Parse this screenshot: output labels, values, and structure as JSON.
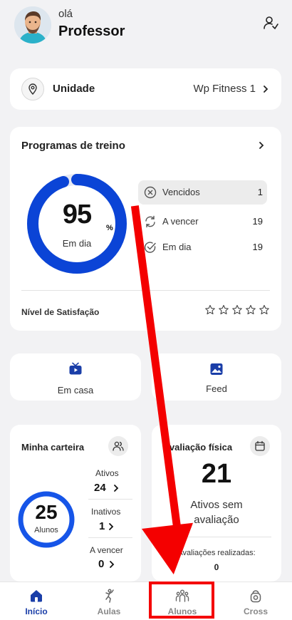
{
  "header": {
    "greeting": "olá",
    "user_name": "Professor"
  },
  "unit": {
    "label": "Unidade",
    "value": "Wp Fitness 1"
  },
  "programs": {
    "title": "Programas de treino",
    "percent": "95",
    "percent_sign": "%",
    "status": "Em dia",
    "progress_fraction": 0.95,
    "stats": [
      {
        "label": "Vencidos",
        "value": "1",
        "icon": "x-circle-icon"
      },
      {
        "label": "A vencer",
        "value": "19",
        "icon": "refresh-icon"
      },
      {
        "label": "Em dia",
        "value": "19",
        "icon": "check-circle-icon"
      }
    ],
    "satisfaction_label": "Nível de Satisfação",
    "stars": 0
  },
  "shortcuts": [
    {
      "label": "Em casa",
      "icon": "tv-icon"
    },
    {
      "label": "Feed",
      "icon": "image-icon"
    }
  ],
  "wallet": {
    "title": "Minha carteira",
    "total": "25",
    "total_label": "Alunos",
    "items": [
      {
        "label": "Ativos",
        "value": "24"
      },
      {
        "label": "Inativos",
        "value": "1"
      },
      {
        "label": "A vencer",
        "value": "0"
      }
    ]
  },
  "evaluation": {
    "title": "Avaliação física",
    "count": "21",
    "count_label_line1": "Ativos sem",
    "count_label_line2": "avaliação",
    "done_label": "Avaliações realizadas:",
    "done_value": "0"
  },
  "nav": [
    {
      "label": "Início",
      "icon": "home-icon",
      "active": true
    },
    {
      "label": "Aulas",
      "icon": "aulas-icon",
      "active": false
    },
    {
      "label": "Alunos",
      "icon": "alunos-icon",
      "active": false
    },
    {
      "label": "Cross",
      "icon": "cross-icon",
      "active": false
    }
  ],
  "colors": {
    "brand": "#1a3ea8",
    "ring": "#0b44d6",
    "annotation": "#f40000"
  }
}
